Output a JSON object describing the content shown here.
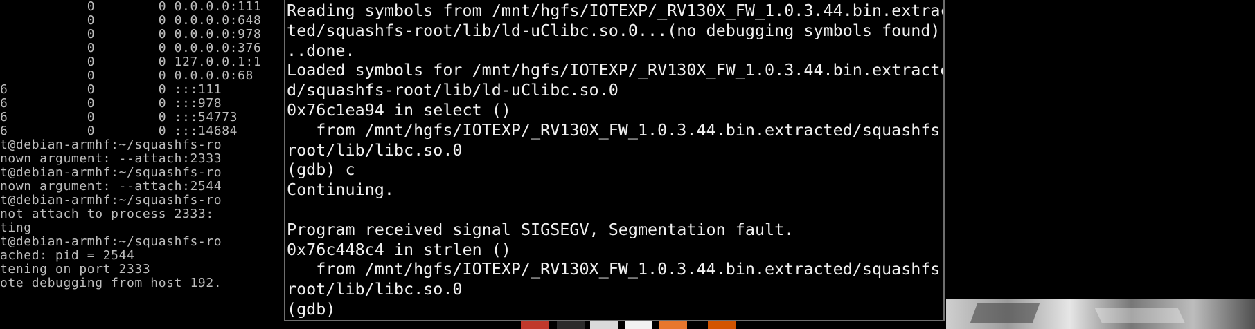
{
  "background_console": {
    "lines": [
      "           0        0 0.0.0.0:111",
      "           0        0 0.0.0.0:648",
      "           0        0 0.0.0.0:978",
      "           0        0 0.0.0.0:376",
      "           0        0 127.0.0.1:1",
      "           0        0 0.0.0.0:68",
      "6          0        0 :::111",
      "6          0        0 :::978",
      "6          0        0 :::54773",
      "6          0        0 :::14684",
      "t@debian-armhf:~/squashfs-ro",
      "nown argument: --attach:2333",
      "t@debian-armhf:~/squashfs-ro",
      "nown argument: --attach:2544",
      "t@debian-armhf:~/squashfs-ro",
      "not attach to process 2333:",
      "ting",
      "t@debian-armhf:~/squashfs-ro",
      "ached: pid = 2544",
      "tening on port 2333",
      "ote debugging from host 192."
    ]
  },
  "gdb_terminal": {
    "lines": [
      "Reading symbols from /mnt/hgfs/IOTEXP/_RV130X_FW_1.0.3.44.bin.extrac",
      "ted/squashfs-root/lib/ld-uClibc.so.0...(no debugging symbols found).",
      "..done.",
      "Loaded symbols for /mnt/hgfs/IOTEXP/_RV130X_FW_1.0.3.44.bin.extracte",
      "d/squashfs-root/lib/ld-uClibc.so.0",
      "0x76c1ea94 in select ()",
      "   from /mnt/hgfs/IOTEXP/_RV130X_FW_1.0.3.44.bin.extracted/squashfs-",
      "root/lib/libc.so.0",
      "(gdb) c",
      "Continuing.",
      "",
      "Program received signal SIGSEGV, Segmentation fault.",
      "0x76c448c4 in strlen ()",
      "   from /mnt/hgfs/IOTEXP/_RV130X_FW_1.0.3.44.bin.extracted/squashfs-",
      "root/lib/libc.so.0",
      "(gdb) "
    ]
  },
  "taskbar": {
    "icons": [
      {
        "name": "app-icon-red",
        "color": "#c0392b"
      },
      {
        "name": "app-icon-dark",
        "color": "#2b2b2b"
      },
      {
        "name": "app-icon-white",
        "color": "#d9d9d9"
      },
      {
        "name": "app-icon-light",
        "color": "#f2f2f2"
      },
      {
        "name": "firefox-icon",
        "color": "#e8772e"
      },
      {
        "name": "app-icon-orange",
        "color": "#d35400"
      }
    ]
  }
}
